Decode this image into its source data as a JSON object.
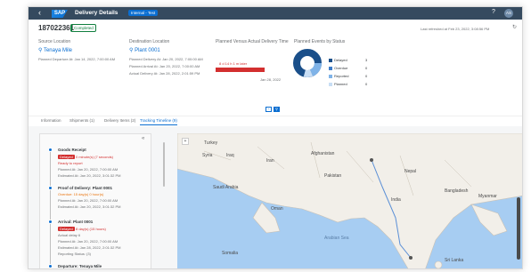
{
  "shell": {
    "back_icon": "back-arrow-icon",
    "logo": "SAP",
    "title": "Delivery Details",
    "badge": "Internal - Test",
    "help_icon": "help-icon",
    "user_initials": "AS"
  },
  "header": {
    "object_id": "187022361",
    "status": "Completed",
    "refreshed": "Last refreshed at Feb 23, 2022, 3:08:56 PM",
    "source": {
      "label": "Source Location",
      "name": "Tenaya Mile",
      "detail": "Planned Departure At: Jan 14, 2022, 7:00:00 AM"
    },
    "destination": {
      "label": "Destination Location",
      "name": "Plant 0001",
      "lines": [
        "Planned Delivery At: Jan 20, 2022, 7:00:00 AM",
        "Planned Arrival At: Jan 20, 2022, 7:00:00 AM",
        "Actual Delivery At: Jan 28, 2022, 2:01:59 PM"
      ]
    },
    "delivery_time": {
      "label": "Planned Versus Actual Delivery Time",
      "delay": "8 d 14 h 1 m later",
      "date": "Jan 28, 2022"
    },
    "events": {
      "label": "Planned Events by Status",
      "legend": [
        {
          "name": "Delayed",
          "value": "3",
          "color": "#1a4f8a"
        },
        {
          "name": "Overdue",
          "value": "0",
          "color": "#3d7cc9"
        },
        {
          "name": "Reported",
          "value": "0",
          "color": "#7fb3e8"
        },
        {
          "name": "Planned",
          "value": "0",
          "color": "#c8def5"
        }
      ]
    }
  },
  "tabs": [
    {
      "label": "Information"
    },
    {
      "label": "Shipments (1)"
    },
    {
      "label": "Delivery Items (2)"
    },
    {
      "label": "Tracking Timeline (9)"
    }
  ],
  "timeline": {
    "events": [
      {
        "title": "Goods Receipt",
        "badge": "Delayed",
        "delay": "0 minute(s) (7 seconds)",
        "lines": [
          "Ready to report",
          "Planned At: Jan 20, 2022, 7:00:00 AM",
          "Estimated At: Jan 20, 2022, 3:01:32 PM"
        ]
      },
      {
        "title": "Proof of Delivery: Plant 0001",
        "orange": [
          "Overdue: 15 day(s) 0 hour(s)",
          "Planned At: Jan 20, 2022, 7:00:00 AM"
        ],
        "lines": [
          "Estimated At: Jan 20, 2022, 3:01:32 PM"
        ]
      },
      {
        "title": "Arrival: Plant 0001",
        "badge": "Delayed",
        "delay": "8 day(s) (15 hours)",
        "lines": [
          "Actual delay 6",
          "Planned At: Jan 20, 2022, 7:00:00 AM",
          "Estimated At: Jan 28, 2022, 2:01:32 PM",
          "Reporting Status: (3)"
        ]
      },
      {
        "title": "Departure: Tenaya Mile"
      }
    ]
  },
  "map": {
    "labels": [
      "Turkey",
      "Syria",
      "Iraq",
      "Iran",
      "Saudi Arabia",
      "Oman",
      "Afghanistan",
      "Pakistan",
      "Nepal",
      "India",
      "Bangladesh",
      "Myanmar",
      "Somalia",
      "Arabian Sea",
      "Sri Lanka"
    ]
  }
}
